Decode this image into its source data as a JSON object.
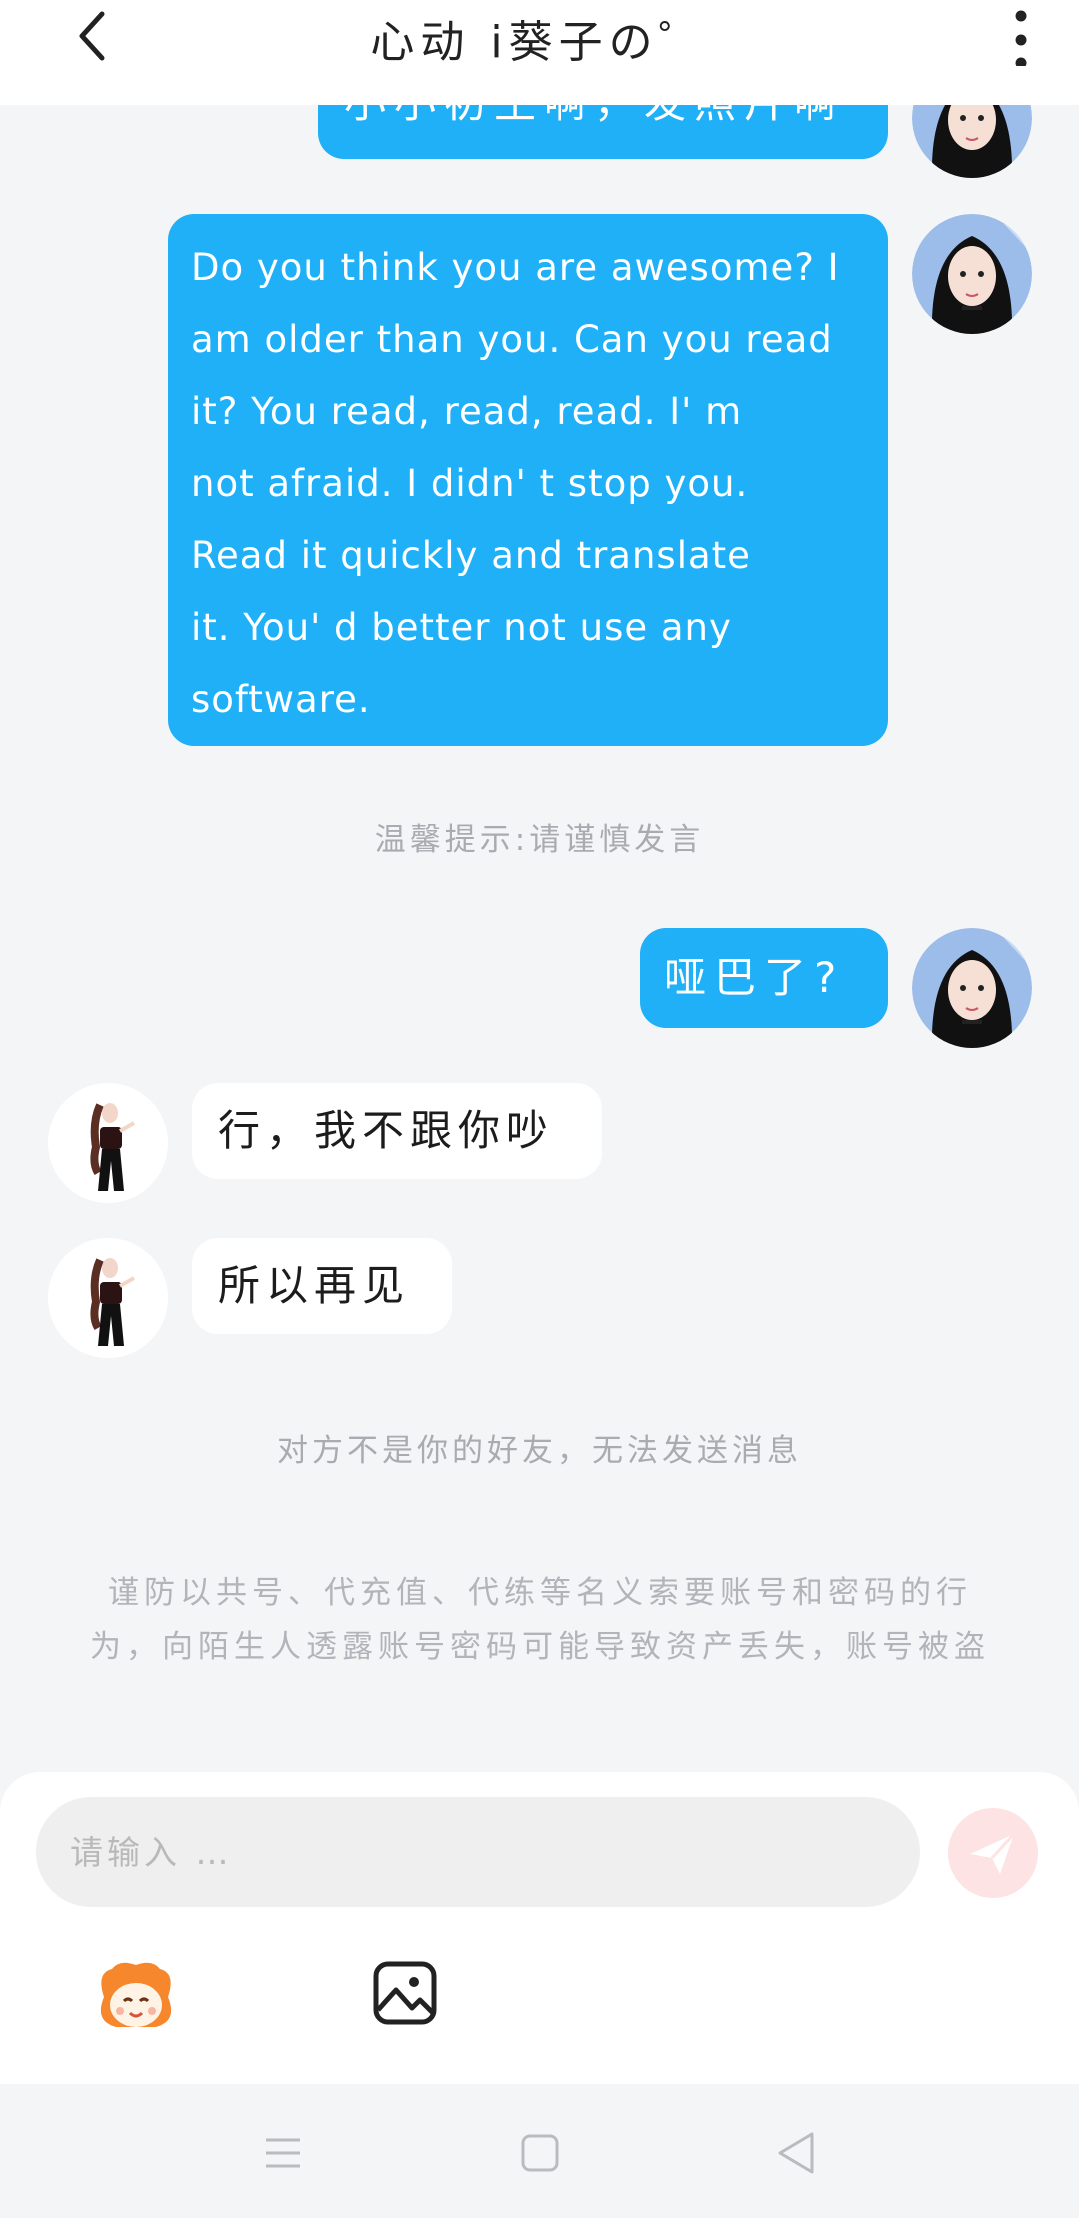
{
  "header": {
    "title": "心动 i葵子の゜"
  },
  "messages": {
    "partial_top": "小小初生啊，发照片啊",
    "long_out": "Do you think you are awesome? I\nam older than you. Can you read\nit? You read, read, read. I' m\nnot afraid. I didn' t stop you.\nRead it quickly and translate\nit. You' d better not use any\nsoftware.",
    "tip": "温馨提示:请谨慎发言",
    "dumb": "哑巴了?",
    "reply1": "行，我不跟你吵",
    "reply2": "所以再见",
    "not_friend": "对方不是你的好友，无法发送消息",
    "warning": "谨防以共号、代充值、代练等名义索要账号和密码的行为，向陌生人透露账号密码可能导致资产丢失，账号被盗"
  },
  "input": {
    "placeholder": "请输入 …"
  },
  "colors": {
    "bubble_out": "#1fb0f8",
    "bubble_in": "#ffffff",
    "send_button": "#fde3e3",
    "background": "#f4f5f7"
  },
  "icons": {
    "back": "chevron-left-icon",
    "more": "more-vertical-icon",
    "send": "send-icon",
    "emoji": "emoji-mascot-icon",
    "image": "image-icon",
    "nav_menu": "menu-icon",
    "nav_home": "home-icon",
    "nav_back": "back-triangle-icon"
  }
}
